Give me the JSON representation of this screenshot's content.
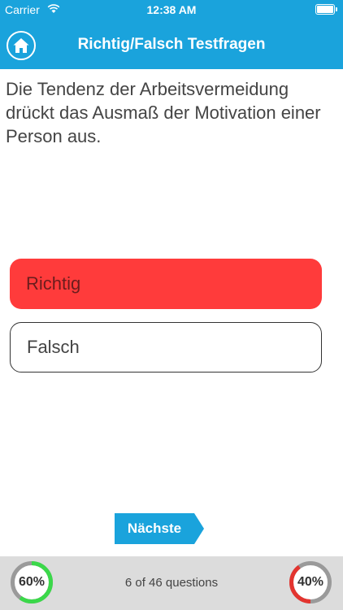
{
  "status_bar": {
    "carrier": "Carrier",
    "time": "12:38 AM"
  },
  "header": {
    "title": "Richtig/Falsch Testfragen",
    "home_icon": "home-icon"
  },
  "question": {
    "text": "Die Tendenz der Arbeitsvermeidung drückt das Ausmaß der Motivation einer Person aus."
  },
  "answers": [
    {
      "label": "Richtig",
      "state": "selected-wrong",
      "color": "#ff3b3b"
    },
    {
      "label": "Falsch",
      "state": "default"
    }
  ],
  "next_button": {
    "label": "Nächste",
    "color": "#1aa3dc"
  },
  "footer": {
    "progress_text": "6 of 46 questions",
    "correct_gauge": {
      "label": "60%",
      "value": 0.6,
      "color": "#3bd84a"
    },
    "wrong_gauge": {
      "label": "40%",
      "value": 0.4,
      "color": "#e3342f"
    }
  },
  "colors": {
    "accent": "#1aa3dc",
    "footer_bg": "#dcdcdc"
  }
}
